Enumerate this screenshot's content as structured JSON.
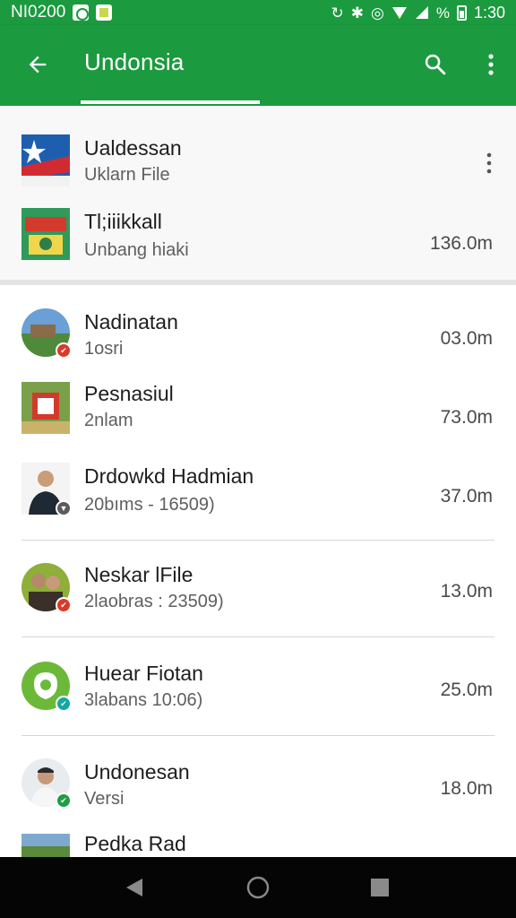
{
  "status_bar": {
    "left_text": "NI0200",
    "right_text": "1:30",
    "percent_text": "%"
  },
  "app_bar": {
    "title": "Undonsia",
    "back_icon": "arrow-back-icon",
    "search_icon": "search-icon",
    "more_icon": "more-vert-icon"
  },
  "header_items": [
    {
      "title": "Ualdessan",
      "subtitle": "Uklarn File",
      "size": ""
    },
    {
      "title": "Tl;iiikkall",
      "subtitle": "Unbang hiaki",
      "size": "136.0m"
    }
  ],
  "items": [
    {
      "title": "Nadinatan",
      "subtitle": "1osri",
      "size": "03.0m",
      "badge": "red"
    },
    {
      "title": "Pesnasiul",
      "subtitle": "2nlam",
      "size": "73.0m",
      "badge": ""
    },
    {
      "title": "Drdowkd Hadmian",
      "subtitle": "20bıms - 16509)",
      "size": "37.0m",
      "badge": "gray"
    },
    {
      "title": "Neskar lFile",
      "subtitle": "2laobras : 23509)",
      "size": "13.0m",
      "badge": "red"
    },
    {
      "title": "Huear Fiotan",
      "subtitle": "3labans 10:06)",
      "size": "25.0m",
      "badge": "teal"
    },
    {
      "title": "Undonesan",
      "subtitle": "Versi",
      "size": "18.0m",
      "badge": "green"
    },
    {
      "title": "Pedka Rad",
      "subtitle": "",
      "size": "",
      "badge": ""
    }
  ],
  "colors": {
    "primary": "#1b9a3f",
    "nav_bar": "#050505"
  }
}
